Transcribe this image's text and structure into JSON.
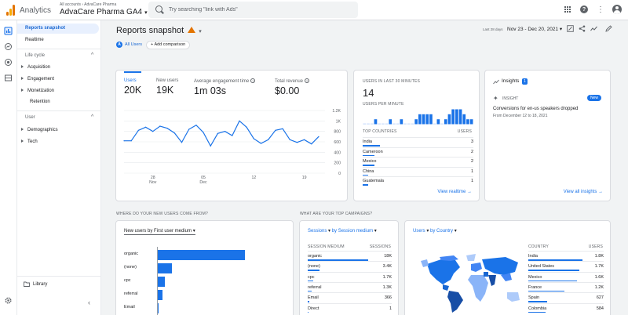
{
  "app": {
    "name": "Analytics",
    "breadcrumb": "All accounts › AdvaCare Pharma",
    "property": "AdvaCare Pharma GA4",
    "search_placeholder": "Try searching \"link with Ads\""
  },
  "nav": {
    "reports_snapshot": "Reports snapshot",
    "realtime": "Realtime",
    "lifecycle": "Life cycle",
    "acquisition": "Acquisition",
    "engagement": "Engagement",
    "monetization": "Monetization",
    "retention": "Retention",
    "user": "User",
    "demographics": "Demographics",
    "tech": "Tech",
    "library": "Library"
  },
  "header": {
    "title": "Reports snapshot",
    "date_label": "Last 28 days",
    "date_range": "Nov 23 - Dec 20, 2021",
    "all_users": "All Users",
    "add_comparison": "Add comparison"
  },
  "overview": {
    "metrics": [
      {
        "label": "Users",
        "value": "20K"
      },
      {
        "label": "New users",
        "value": "19K"
      },
      {
        "label": "Average engagement time",
        "value": "1m 03s"
      },
      {
        "label": "Total revenue",
        "value": "$0.00"
      }
    ]
  },
  "chart_data": {
    "type": "line",
    "x": [
      1,
      2,
      3,
      4,
      5,
      6,
      7,
      8,
      9,
      10,
      11,
      12,
      13,
      14,
      15,
      16,
      17,
      18,
      19,
      20,
      21,
      22,
      23,
      24,
      25,
      26,
      27,
      28
    ],
    "x_tick_labels": [
      "28\nNov",
      "05\nDec",
      "12",
      "19"
    ],
    "y_tick_labels": [
      "1.2K",
      "1K",
      "800",
      "600",
      "400",
      "200",
      "0"
    ],
    "ylim": [
      0,
      1200
    ],
    "series": [
      {
        "values": [
          620,
          620,
          820,
          880,
          800,
          900,
          860,
          770,
          590,
          840,
          920,
          780,
          520,
          760,
          800,
          720,
          1000,
          880,
          660,
          570,
          640,
          820,
          850,
          640,
          590,
          640,
          560,
          700
        ]
      }
    ]
  },
  "realtime": {
    "label": "USERS IN LAST 30 MINUTES",
    "value": "14",
    "per_minute": "USERS PER MINUTE",
    "bars": [
      0,
      0,
      0,
      1,
      0,
      0,
      0,
      1,
      0,
      0,
      1,
      0,
      0,
      0,
      1,
      2,
      2,
      2,
      2,
      0,
      1,
      0,
      1,
      2,
      3,
      3,
      3,
      2,
      1,
      1
    ],
    "top_countries": "TOP COUNTRIES",
    "users_hdr": "USERS",
    "countries": [
      {
        "name": "India",
        "value": "3"
      },
      {
        "name": "Cameroon",
        "value": "2"
      },
      {
        "name": "Mexico",
        "value": "2"
      },
      {
        "name": "China",
        "value": "1"
      },
      {
        "name": "Guatemala",
        "value": "1"
      }
    ],
    "view_link": "View realtime"
  },
  "insights": {
    "title": "Insights",
    "count": "1",
    "insight_label": "INSIGHT",
    "new_badge": "New",
    "headline": "Conversions for en-us speakers dropped",
    "date": "From December 12 to 18, 2021",
    "view_all": "View all insights"
  },
  "new_users": {
    "section": "WHERE DO YOUR NEW USERS COME FROM?",
    "selector": "New users by First user medium",
    "rows": [
      {
        "label": "organic",
        "value": 100
      },
      {
        "label": "(none)",
        "value": 17
      },
      {
        "label": "cpc",
        "value": 9
      },
      {
        "label": "referral",
        "value": 6
      },
      {
        "label": "Email",
        "value": 2
      }
    ]
  },
  "campaigns": {
    "section": "WHAT ARE YOUR TOP CAMPAIGNS?",
    "selector_a": "Sessions",
    "selector_b": "by Session medium",
    "col_a": "SESSION MEDIUM",
    "col_b": "SESSIONS",
    "rows": [
      {
        "k": "organic",
        "v": "18K",
        "frac": 1.0
      },
      {
        "k": "(none)",
        "v": "3.4K",
        "frac": 0.19
      },
      {
        "k": "cpc",
        "v": "1.7K",
        "frac": 0.09
      },
      {
        "k": "referral",
        "v": "1.3K",
        "frac": 0.07
      },
      {
        "k": "Email",
        "v": "366",
        "frac": 0.02
      },
      {
        "k": "Direct",
        "v": "1",
        "frac": 0.005
      }
    ]
  },
  "countries": {
    "selector_a": "Users",
    "selector_b": "by Country",
    "col_a": "COUNTRY",
    "col_b": "USERS",
    "rows": [
      {
        "k": "India",
        "v": "1.8K",
        "frac": 1.0
      },
      {
        "k": "United States",
        "v": "1.7K",
        "frac": 0.94
      },
      {
        "k": "Mexico",
        "v": "1.6K",
        "frac": 0.89
      },
      {
        "k": "France",
        "v": "1.2K",
        "frac": 0.67
      },
      {
        "k": "Spain",
        "v": "627",
        "frac": 0.35
      },
      {
        "k": "Colombia",
        "v": "584",
        "frac": 0.32
      }
    ]
  },
  "colors": {
    "accent": "#1a73e8",
    "warn": "#e37400"
  }
}
